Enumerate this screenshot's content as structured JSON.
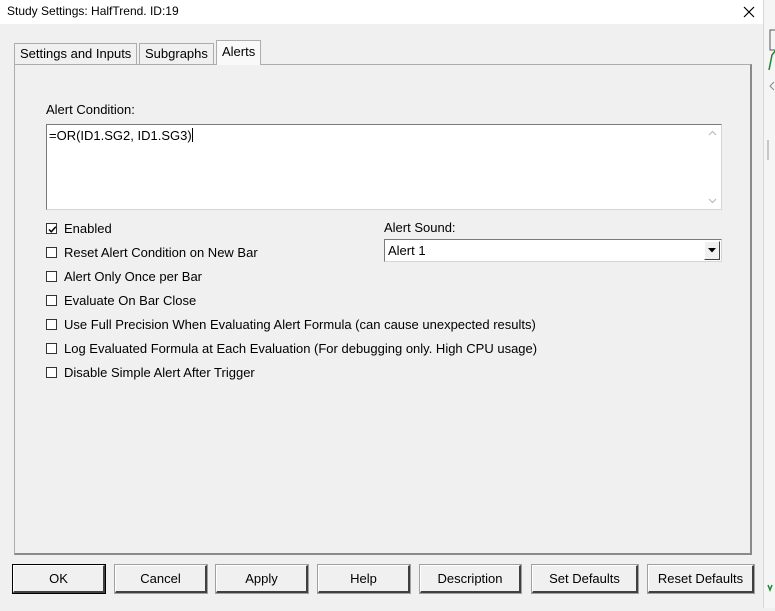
{
  "window": {
    "title": "Study Settings: HalfTrend. ID:19",
    "close_glyph": "✕"
  },
  "tabs": [
    {
      "label": "Settings and Inputs"
    },
    {
      "label": "Subgraphs"
    },
    {
      "label": "Alerts",
      "active": true
    }
  ],
  "alerts": {
    "condition_label": "Alert Condition:",
    "condition_value": "=OR(ID1.SG2, ID1.SG3)",
    "sound_label": "Alert Sound:",
    "sound_value": "Alert 1",
    "checkboxes": [
      {
        "label": "Enabled",
        "checked": true
      },
      {
        "label": "Reset Alert Condition on New Bar",
        "checked": false
      },
      {
        "label": "Alert Only Once per Bar",
        "checked": false
      },
      {
        "label": "Evaluate On Bar Close",
        "checked": false
      },
      {
        "label": "Use Full Precision When Evaluating Alert Formula (can cause unexpected results)",
        "checked": false
      },
      {
        "label": "Log Evaluated Formula at Each Evaluation (For debugging only. High CPU usage)",
        "checked": false
      },
      {
        "label": "Disable Simple Alert After Trigger",
        "checked": false
      }
    ]
  },
  "buttons": {
    "ok": "OK",
    "cancel": "Cancel",
    "apply": "Apply",
    "help": "Help",
    "description": "Description",
    "set_defaults": "Set Defaults",
    "reset_defaults": "Reset Defaults"
  },
  "colors": {
    "window_bg": "#f0f0f0",
    "chart_line": "#1a8a2a"
  }
}
